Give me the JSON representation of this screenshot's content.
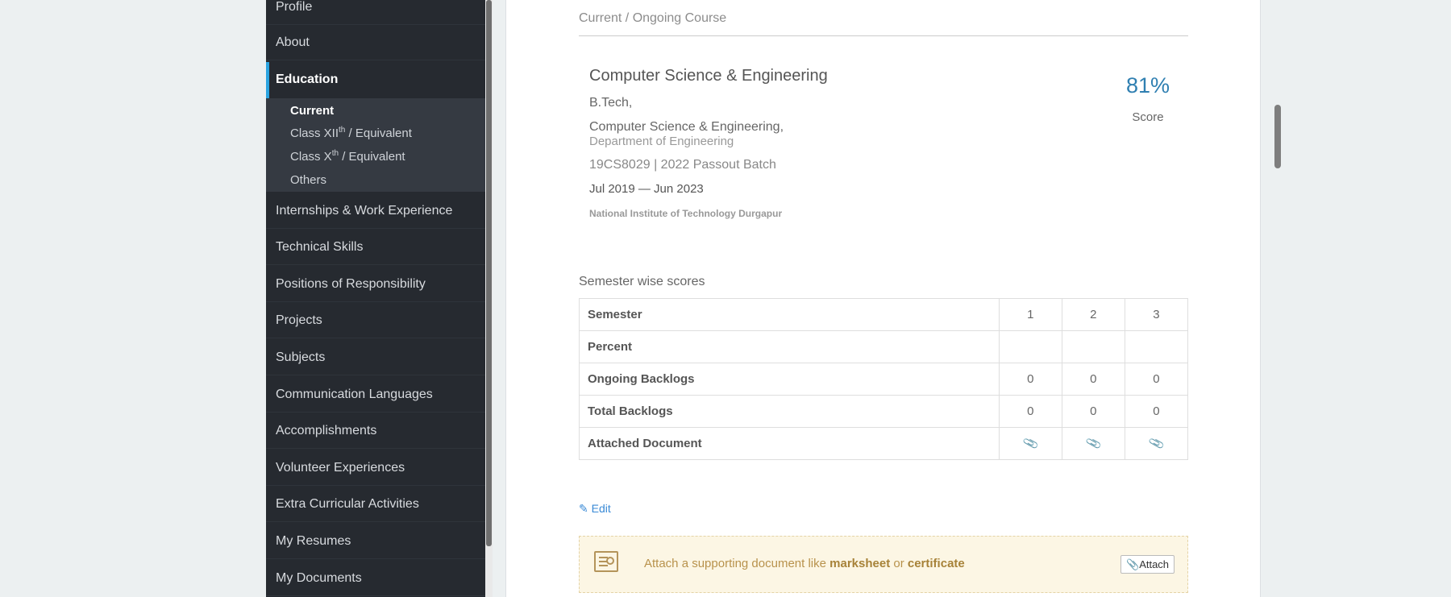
{
  "sidebar": {
    "items": [
      {
        "label": "Profile"
      },
      {
        "label": "About"
      },
      {
        "label": "Education"
      },
      {
        "label": "Internships & Work Experience"
      },
      {
        "label": "Technical Skills"
      },
      {
        "label": "Positions of Responsibility"
      },
      {
        "label": "Projects"
      },
      {
        "label": "Subjects"
      },
      {
        "label": "Communication Languages"
      },
      {
        "label": "Accomplishments"
      },
      {
        "label": "Volunteer Experiences"
      },
      {
        "label": "Extra Curricular Activities"
      },
      {
        "label": "My Resumes"
      },
      {
        "label": "My Documents"
      }
    ],
    "education_sub": {
      "current": "Current",
      "class12_prefix": "Class XII",
      "class12_sup": "th",
      "class12_suffix": " / Equivalent",
      "class10_prefix": "Class X",
      "class10_sup": "th",
      "class10_suffix": " / Equivalent",
      "others": "Others"
    },
    "active_color": "#2aa3e0"
  },
  "main": {
    "section_title": "Current / Ongoing Course",
    "course": {
      "name": "Computer Science & Engineering",
      "degree": "B.Tech,",
      "branch": "Computer Science & Engineering,",
      "department": "Department of Engineering",
      "roll_batch": "19CS8029 | 2022 Passout Batch",
      "duration": "Jul 2019 — Jun 2023",
      "institute": "National Institute of Technology Durgapur",
      "score": "81%",
      "score_label": "Score"
    },
    "semester": {
      "title": "Semester wise scores",
      "row_labels": {
        "semester": "Semester",
        "percent": "Percent",
        "ongoing": "Ongoing Backlogs",
        "total": "Total Backlogs",
        "document": "Attached Document"
      },
      "semesters": [
        "1",
        "2",
        "3"
      ],
      "percent": [
        "",
        "",
        ""
      ],
      "ongoing_backlogs": [
        "0",
        "0",
        "0"
      ],
      "total_backlogs": [
        "0",
        "0",
        "0"
      ],
      "document_icon": "paperclip-icon"
    },
    "edit_label": "Edit",
    "attach": {
      "text_before": "Attach a supporting document like ",
      "marksheet": "marksheet",
      "text_or": " or ",
      "certificate": "certificate",
      "button_label": "Attach",
      "icon": "certificate-icon"
    }
  }
}
